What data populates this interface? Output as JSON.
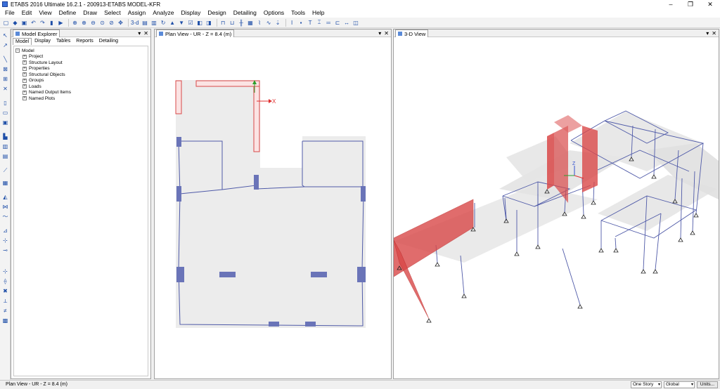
{
  "window": {
    "title": "ETABS 2016 Ultimate 16.2.1 - 200913-ETABS MODEL-KFR",
    "minimize": "–",
    "maximize": "❐",
    "close": "✕"
  },
  "menu": [
    "File",
    "Edit",
    "View",
    "Define",
    "Draw",
    "Select",
    "Assign",
    "Analyze",
    "Display",
    "Design",
    "Detailing",
    "Options",
    "Tools",
    "Help"
  ],
  "toolbar": {
    "view_3d_label": "3-d"
  },
  "model_explorer": {
    "title": "Model Explorer",
    "pin": "▾",
    "close": "✕",
    "tabs": [
      "Model",
      "Display",
      "Tables",
      "Reports",
      "Detailing"
    ],
    "active_tab": "Model",
    "tree_root": "Model",
    "tree_items": [
      "Project",
      "Structure Layout",
      "Properties",
      "Structural Objects",
      "Groups",
      "Loads",
      "Named Output Items",
      "Named Plots"
    ]
  },
  "plan_view": {
    "title": "Plan View - UR - Z = 8.4 (m)",
    "axis_x": "X",
    "pin": "▾",
    "close": "✕"
  },
  "view_3d": {
    "title": "3-D View",
    "axis_z": "Z",
    "pin": "▾",
    "close": "✕"
  },
  "status": {
    "text": "Plan View - UR - Z = 8.4 (m)",
    "story": "One Story",
    "coord": "Global",
    "units": "Units..."
  },
  "colors": {
    "column": "#6a74b8",
    "wall": "#d94848",
    "beam": "#4f5aa8",
    "slab": "#ebebeb"
  }
}
